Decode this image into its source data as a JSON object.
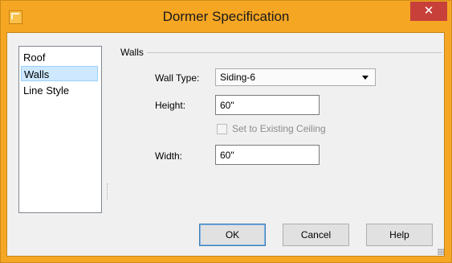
{
  "window": {
    "title": "Dormer Specification",
    "close_label": "✕"
  },
  "nav": {
    "items": [
      {
        "label": "Roof"
      },
      {
        "label": "Walls"
      },
      {
        "label": "Line Style"
      }
    ],
    "selected": "Walls"
  },
  "walls": {
    "group_label": "Walls",
    "wall_type_label": "Wall Type:",
    "wall_type_value": "Siding-6",
    "height_label": "Height:",
    "height_value": "60\"",
    "set_to_ceiling_label": "Set to Existing Ceiling",
    "set_to_ceiling_checked": false,
    "width_label": "Width:",
    "width_value": "60\""
  },
  "buttons": {
    "ok": "OK",
    "cancel": "Cancel",
    "help": "Help"
  },
  "colors": {
    "titlebar": "#f5a623",
    "close": "#c7403a",
    "selection": "#cde8ff"
  }
}
